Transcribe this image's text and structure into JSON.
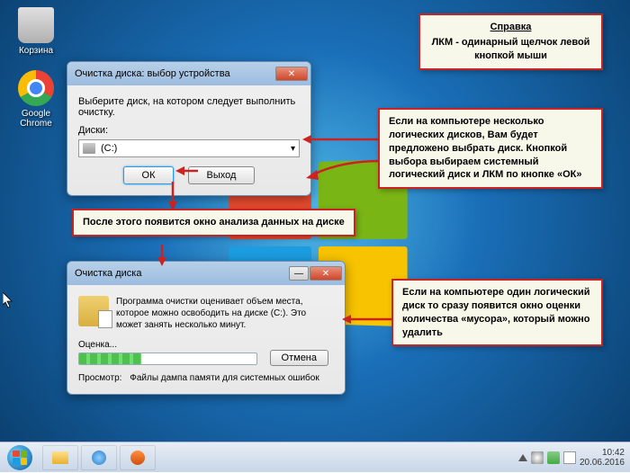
{
  "desktop": {
    "icons": {
      "recycle_bin": "Корзина",
      "chrome": "Google Chrome"
    }
  },
  "dialog1": {
    "title": "Очистка диска: выбор устройства",
    "instruction": "Выберите диск, на котором следует выполнить очистку.",
    "drives_label": "Диски:",
    "selected_drive": "(C:)",
    "ok_label": "ОК",
    "exit_label": "Выход"
  },
  "dialog2": {
    "title": "Очистка диска",
    "message": "Программа очистки оценивает объем места, которое можно освободить на диске (C:). Это может занять несколько минут.",
    "progress_label": "Оценка...",
    "cancel_label": "Отмена",
    "view_label": "Просмотр:",
    "view_value": "Файлы дампа памяти для системных ошибок"
  },
  "tooltips": {
    "t1_title": "Справка",
    "t1_body": "ЛКМ - одинарный щелчок левой кнопкой мыши",
    "t2": "Если на компьютере несколько логических дисков, Вам будет предложено выбрать диск. Кнопкой выбора выбираем системный логический диск и ЛКМ по кнопке «ОК»",
    "t3": "После этого появится окно анализа данных на диске",
    "t4": "Если на компьютере один логический диск то сразу появится окно оценки количества «мусора», который можно удалить"
  },
  "taskbar": {
    "time": "10:42",
    "date": "20.06.2016"
  }
}
